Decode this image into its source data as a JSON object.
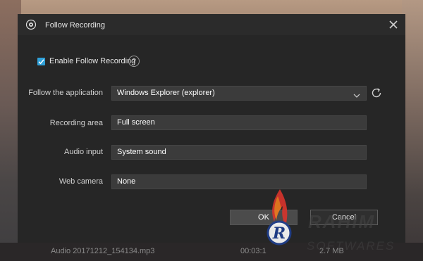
{
  "background": {
    "file_name": "Audio 20171212_154134.mp3",
    "duration": "00:03:1",
    "size": "2.7 MB"
  },
  "dialog": {
    "title": "Follow Recording",
    "enable_label": "Enable Follow Recording",
    "enable_checked": true,
    "help_symbol": "?",
    "follow_app_label": "Follow the application",
    "follow_app_value": "Windows Explorer (explorer)",
    "recording_area_label": "Recording area",
    "recording_area_value": "Full screen",
    "audio_input_label": "Audio input",
    "audio_input_value": "System sound",
    "web_camera_label": "Web camera",
    "web_camera_value": "None",
    "ok_label": "OK",
    "cancel_label": "Cancel"
  },
  "watermark": {
    "line1": "RAHIM",
    "line2": "SOFTWARES"
  },
  "colors": {
    "accent": "#2fa0d8",
    "dialog_bg": "#262626",
    "field_bg": "#3b3b3b",
    "logo_red": "#d8342c",
    "logo_orange": "#f07c1e",
    "logo_blue": "#1f3f8f"
  },
  "icons": [
    "app-record-icon",
    "close-icon",
    "check-icon",
    "help-icon",
    "chevron-down-icon",
    "refresh-icon",
    "watermark-logo-icon"
  ]
}
